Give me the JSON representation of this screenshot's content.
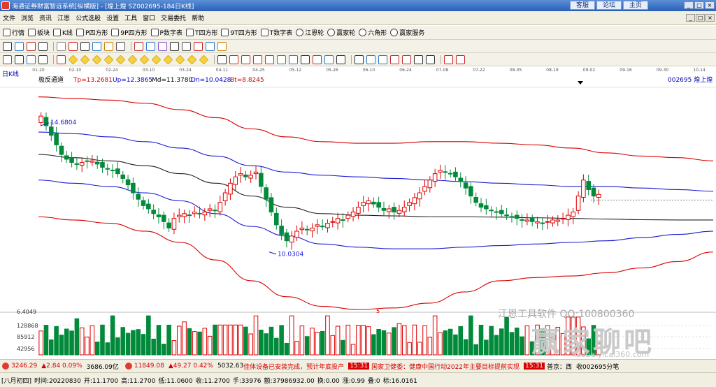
{
  "window": {
    "title": "海通证券财富智远系统[纵横版] - [煌上煌 SZ002695-184日K线]",
    "links": [
      "客服",
      "论坛",
      "主页"
    ],
    "controls": [
      "_",
      "□",
      "×"
    ]
  },
  "menu": [
    "文件",
    "浏览",
    "资讯",
    "江恩",
    "公式选股",
    "设置",
    "工具",
    "窗口",
    "交易委托",
    "帮助"
  ],
  "toolbar": [
    {
      "label": "行情",
      "icon": "grid-icon"
    },
    {
      "label": "板块",
      "icon": "blocks-icon"
    },
    {
      "label": "K线",
      "icon": "candle-icon"
    },
    {
      "label": "P四方形",
      "icon": "p-square-icon"
    },
    {
      "label": "9P四方形",
      "icon": "9p-square-icon"
    },
    {
      "label": "P数字表",
      "icon": "p-table-icon"
    },
    {
      "label": "T四方形",
      "icon": "t-square-icon"
    },
    {
      "label": "9T四方形",
      "icon": "9t-square-icon"
    },
    {
      "label": "T数字表",
      "icon": "t-table-icon"
    },
    {
      "label": "江恩轮",
      "icon": "gann-wheel-icon"
    },
    {
      "label": "赢家轮",
      "icon": "winner-wheel-icon"
    },
    {
      "label": "六角形",
      "icon": "hexagon-icon"
    },
    {
      "label": "赢家服务",
      "icon": "service-icon"
    }
  ],
  "chart_data": {
    "type": "line",
    "panel_label": "日K线",
    "indicator": "极反通道",
    "indicator_values": [
      {
        "name": "Tp",
        "value": "13.2681",
        "color": "#d80000"
      },
      {
        "name": "Up",
        "value": "12.3865",
        "color": "#0000d0"
      },
      {
        "name": "Md",
        "value": "11.3780",
        "color": "#000000"
      },
      {
        "name": "Dn",
        "value": "10.0428",
        "color": "#0000d0"
      },
      {
        "name": "Bt",
        "value": "8.8245",
        "color": "#d80000"
      }
    ],
    "stock_code": "002695 煌上煌",
    "date_ticks": [
      "01-20",
      "02-10",
      "02-24",
      "03-10",
      "03-24",
      "04-11",
      "04-25",
      "05-12",
      "05-26",
      "06-10",
      "06-24",
      "07-08",
      "07-22",
      "08-05",
      "08-19",
      "09-02",
      "09-16",
      "09-30",
      "10-14"
    ],
    "annotations": {
      "high": "14.6804",
      "low": "10.0304"
    },
    "ylim": [
      8.4,
      15.5
    ],
    "close": [
      14.6,
      14.3,
      14.0,
      13.7,
      13.4,
      13.25,
      13.15,
      13.1,
      13.15,
      13.2,
      13.2,
      13.1,
      13.0,
      12.95,
      12.9,
      12.8,
      12.65,
      12.45,
      12.2,
      12.0,
      11.8,
      11.7,
      11.55,
      11.45,
      11.3,
      11.1,
      11.4,
      11.5,
      11.55,
      11.5,
      11.6,
      11.55,
      11.6,
      11.7,
      11.65,
      11.9,
      12.2,
      12.5,
      12.7,
      12.8,
      12.7,
      12.75,
      12.85,
      12.4,
      12.0,
      11.6,
      11.2,
      10.9,
      10.7,
      10.85,
      11.0,
      11.1,
      11.05,
      11.1,
      11.2,
      11.15,
      11.25,
      11.3,
      11.4,
      11.35,
      11.5,
      11.6,
      11.75,
      11.9,
      11.95,
      11.85,
      11.75,
      11.65,
      11.7,
      11.6,
      11.65,
      11.75,
      11.9,
      12.05,
      12.2,
      12.4,
      12.6,
      12.8,
      12.9,
      12.85,
      12.8,
      12.7,
      12.55,
      12.35,
      12.1,
      11.9,
      11.75,
      11.7,
      11.65,
      11.6,
      11.55,
      11.5,
      11.45,
      11.4,
      11.35,
      11.35,
      11.3,
      11.3,
      11.25,
      11.3,
      11.35,
      11.35,
      11.4,
      11.5,
      11.6,
      12.1,
      12.6,
      12.3,
      12.1,
      12.15
    ],
    "channel_tp": [
      15.2,
      15.15,
      15.1,
      15.0,
      14.8,
      14.55,
      14.2,
      13.95,
      13.8,
      13.75,
      13.75,
      13.8,
      13.8,
      13.75,
      13.7,
      13.6,
      13.45,
      13.35,
      13.3,
      13.2
    ],
    "channel_up": [
      14.1,
      14.05,
      13.95,
      13.8,
      13.6,
      13.35,
      13.05,
      12.85,
      12.75,
      12.7,
      12.65,
      12.6,
      12.55,
      12.5,
      12.45,
      12.4,
      12.4,
      12.35,
      12.3,
      12.25
    ],
    "channel_md": [
      13.4,
      13.3,
      13.2,
      13.05,
      12.8,
      12.5,
      12.1,
      11.75,
      11.55,
      11.5,
      11.48,
      11.45,
      11.45,
      11.44,
      11.42,
      11.4,
      11.38,
      11.36,
      11.35,
      11.35
    ],
    "channel_dn": [
      12.6,
      12.5,
      12.4,
      12.2,
      11.95,
      11.55,
      11.15,
      10.85,
      10.6,
      10.5,
      10.45,
      10.45,
      10.5,
      10.55,
      10.6,
      10.65,
      10.7,
      10.8,
      10.9,
      11.0
    ],
    "channel_bt": [
      11.45,
      11.35,
      11.25,
      11.0,
      10.65,
      10.1,
      9.45,
      8.95,
      8.65,
      8.55,
      8.6,
      8.75,
      9.1,
      9.45,
      9.55,
      9.6,
      9.7,
      9.85,
      10.05,
      10.35
    ],
    "volume_axis": [
      "6.4049",
      "128868",
      "85912",
      "42956"
    ],
    "volume_marker": "5"
  },
  "status_bar": {
    "sh_index": "3246.29",
    "sh_change": "▲2.84 0.09%",
    "sh_amount": "3686.09亿",
    "sz_index": "11849.08",
    "sz_change": "▲49.27 0.42%",
    "sz_amount": "5032.63",
    "news_1": "佳体设备已安装完成，预计年底投产",
    "news_time": "15:31",
    "news_2": "国家卫健委：健康中国行动2022年主要目标提前实现",
    "news_time_2": "15:31",
    "news_3": "普京：西",
    "stock_tag": "收002695分笔"
  },
  "info_bar": {
    "date_label": "[八月初四]",
    "time": "时间:20220830",
    "open": "开:11.1700",
    "high": "高:11.2700",
    "low": "低:11.0600",
    "close": "收:11.2700",
    "hands": "手:33976",
    "amount": "额:37986932.00",
    "change": "换:0.00",
    "up": "涨:0.99",
    "fall": "叠:0",
    "mark": "标:16.0161"
  },
  "watermarks": {
    "brand": "江恩工具软件  QQ:100800360",
    "site": "赢家聊吧",
    "url": "liaoba.yicai360.com"
  }
}
